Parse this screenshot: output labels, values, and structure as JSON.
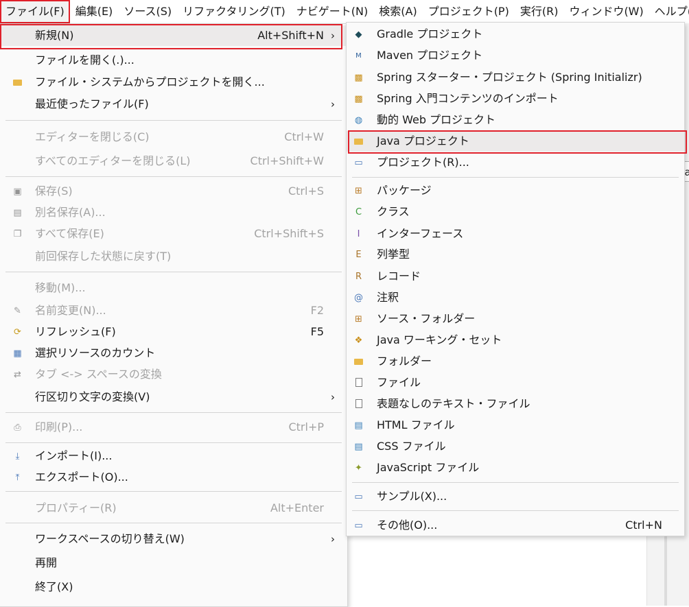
{
  "menubar": {
    "items": [
      "ファイル(F)",
      "編集(E)",
      "ソース(S)",
      "リファクタリング(T)",
      "ナビゲート(N)",
      "検索(A)",
      "プロジェクト(P)",
      "実行(R)",
      "ウィンドウ(W)",
      "ヘルプ(H)"
    ]
  },
  "file_menu": {
    "new": {
      "label": "新規(N)",
      "shortcut": "Alt+Shift+N"
    },
    "open_file": {
      "label": "ファイルを開く(.)..."
    },
    "open_fs": {
      "label": "ファイル・システムからプロジェクトを開く..."
    },
    "recent": {
      "label": "最近使ったファイル(F)"
    },
    "close_editor": {
      "label": "エディターを閉じる(C)",
      "shortcut": "Ctrl+W"
    },
    "close_all": {
      "label": "すべてのエディターを閉じる(L)",
      "shortcut": "Ctrl+Shift+W"
    },
    "save": {
      "label": "保存(S)",
      "shortcut": "Ctrl+S"
    },
    "save_as": {
      "label": "別名保存(A)..."
    },
    "save_all": {
      "label": "すべて保存(E)",
      "shortcut": "Ctrl+Shift+S"
    },
    "revert": {
      "label": "前回保存した状態に戻す(T)"
    },
    "move": {
      "label": "移動(M)..."
    },
    "rename": {
      "label": "名前変更(N)...",
      "shortcut": "F2"
    },
    "refresh": {
      "label": "リフレッシュ(F)",
      "shortcut": "F5"
    },
    "count": {
      "label": "選択リソースのカウント"
    },
    "tabs_spaces": {
      "label": "タブ <-> スペースの変換"
    },
    "line_delim": {
      "label": "行区切り文字の変換(V)"
    },
    "print": {
      "label": "印刷(P)...",
      "shortcut": "Ctrl+P"
    },
    "import": {
      "label": "インポート(I)..."
    },
    "export": {
      "label": "エクスポート(O)..."
    },
    "properties": {
      "label": "プロパティー(R)",
      "shortcut": "Alt+Enter"
    },
    "switch_ws": {
      "label": "ワークスペースの切り替え(W)"
    },
    "restart": {
      "label": "再開"
    },
    "exit": {
      "label": "終了(X)"
    }
  },
  "new_submenu": {
    "gradle": "Gradle プロジェクト",
    "maven": "Maven プロジェクト",
    "spring_starter": "Spring スターター・プロジェクト (Spring Initializr)",
    "spring_guide": "Spring 入門コンテンツのインポート",
    "dynamic_web": "動的 Web プロジェクト",
    "java_project": "Java プロジェクト",
    "project": "プロジェクト(R)...",
    "package": "パッケージ",
    "class": "クラス",
    "interface": "インターフェース",
    "enum": "列挙型",
    "record": "レコード",
    "annotation": "注釈",
    "source_folder": "ソース・フォルダー",
    "working_set": "Java ワーキング・セット",
    "folder": "フォルダー",
    "file": "ファイル",
    "untitled_text": "表題なしのテキスト・ファイル",
    "html_file": "HTML ファイル",
    "css_file": "CSS ファイル",
    "js_file": "JavaScript ファイル",
    "sample": "サンプル(X)...",
    "other": {
      "label": "その他(O)...",
      "shortcut": "Ctrl+N"
    }
  },
  "tooltip": "Java"
}
